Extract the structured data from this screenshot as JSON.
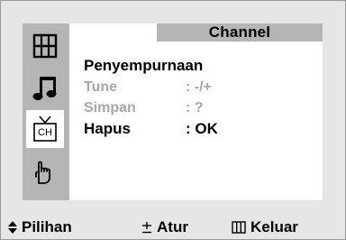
{
  "osd": {
    "title": "Channel",
    "heading": "Penyempurnaan",
    "rows": [
      {
        "label": "Tune",
        "value": ": -/+",
        "enabled": false
      },
      {
        "label": "Simpan",
        "value": ":  ?",
        "enabled": false
      },
      {
        "label": "Hapus",
        "value": ": OK",
        "enabled": true
      }
    ]
  },
  "sidebar": {
    "items": [
      {
        "icon": "picture-icon",
        "label": ""
      },
      {
        "icon": "music-note-icon",
        "label": ""
      },
      {
        "icon": "tv-channel-icon",
        "label": "CH"
      },
      {
        "icon": "hand-icon",
        "label": ""
      }
    ],
    "active_index": 2
  },
  "footer": {
    "hints": [
      {
        "icon": "up-down-arrows-icon",
        "label": "Pilihan"
      },
      {
        "icon": "plus-minus-icon",
        "label": "Atur"
      },
      {
        "icon": "menu-grid-icon",
        "label": "Keluar"
      }
    ]
  },
  "colors": {
    "frame_bg": "#e6e6e6",
    "panel_bg": "#ffffff",
    "sidebar_bg": "#b5b5b5",
    "title_bg": "#b5b5b5",
    "text": "#000000",
    "text_disabled": "#a8a8a8"
  }
}
